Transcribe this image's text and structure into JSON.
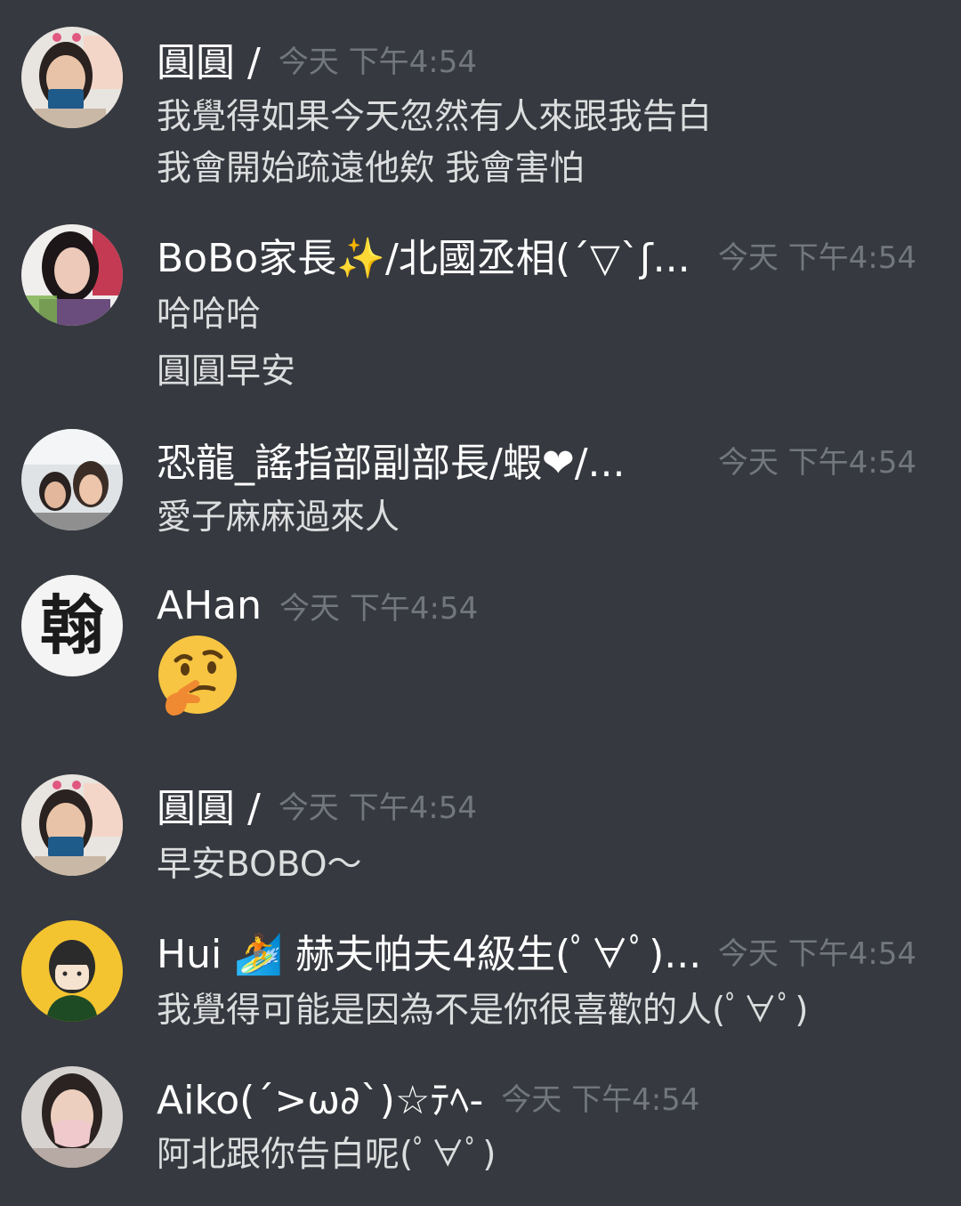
{
  "colors": {
    "background": "#36393f",
    "name": "#ffffff",
    "text": "#dcddde",
    "timestamp": "#72767d"
  },
  "messages": [
    {
      "author": "圓圓 /",
      "timestamp": "今天 下午4:54",
      "lines": [
        "我覺得如果今天忽然有人來跟我告白",
        "我會開始疏遠他欸 我會害怕"
      ]
    },
    {
      "author": "BoBo家長✨/北國丞相(´▽`ʃ...",
      "timestamp": "今天 下午4:54",
      "lines": [
        "哈哈哈",
        "圓圓早安"
      ]
    },
    {
      "author": "恐龍_謠指部副部長/蝦❤/...",
      "timestamp": "今天 下午4:54",
      "lines": [
        "愛子麻麻過來人"
      ]
    },
    {
      "author": "AHan",
      "timestamp": "今天 下午4:54",
      "avatar_text": "翰",
      "emoji": "thinking-face-emoji"
    },
    {
      "author": "圓圓 /",
      "timestamp": "今天 下午4:54",
      "lines": [
        "早安BOBO～"
      ]
    },
    {
      "author": "Hui 🏄 赫夫帕夫4級生(ﾟ∀ﾟ)...",
      "timestamp": "今天 下午4:54",
      "lines": [
        "我覺得可能是因為不是你很喜歡的人(ﾟ∀ﾟ)"
      ]
    },
    {
      "author": "Aiko(´>ω∂`)☆ﾃﾍ-",
      "timestamp": "今天 下午4:54",
      "lines": [
        "阿北跟你告白呢(ﾟ∀ﾟ)"
      ]
    }
  ]
}
